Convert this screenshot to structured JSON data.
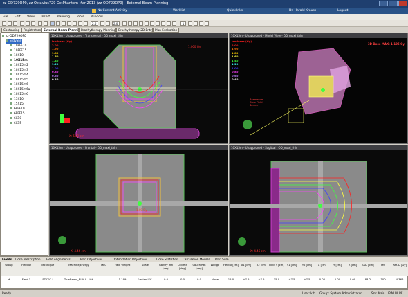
{
  "window": {
    "title": "zz-OD729OP0, zz-Octavius729 OctPhantom Mar 2013 (zz-OD729OP0) - External Beam Planning",
    "nav_activity": "No Current Activity",
    "nav_worklist": "Worklist",
    "nav_quicklinks": "Quicklinks",
    "nav_user": "Dr. Harald Krauss",
    "nav_logout": "Logout"
  },
  "menu": [
    "File",
    "Edit",
    "View",
    "Insert",
    "Planning",
    "Tools",
    "Window"
  ],
  "toolbar": {
    "zoom_a": "2.0",
    "zoom_b": "2.0",
    "page": "1"
  },
  "workspace_tabs": [
    "Contouring",
    "Registration",
    "External Beam Planning",
    "Brachytherapy Planning",
    "Brachytherapy 2D Entry",
    "Plan Evaluation"
  ],
  "tree": {
    "root": "zz-OD729OP0",
    "course": "StdvSEF",
    "plans": [
      "10FFF10",
      "10FFF15",
      "10X10",
      "10X15m",
      "10X15m2",
      "10X15m3",
      "10X15m4",
      "10X15m5",
      "10X15m6",
      "10X15m6a",
      "10X15m6",
      "15X10",
      "15X15",
      "6FFF10",
      "6FFF15",
      "6X10",
      "6X15"
    ]
  },
  "viewports": {
    "transversal": {
      "title": "10X15m - Unapproved - Transversal - OD_maxi_thin",
      "scale": "X: 5.82 cm"
    },
    "model": {
      "title": "10X15m - Unapproved - Model View - OD_maxi_thin",
      "maxlabel": "3D Dose MAX: 1.105 Gy",
      "cursor_note": "Beamzoom Dose Field Source"
    },
    "frontal": {
      "title": "10X15m - Unapproved - Frontal - OD_maxi_thin",
      "scale": "X: 4.46 cm"
    },
    "sagittal": {
      "title": "10X15m - Unapproved - Sagittal - OD_maxi_thin",
      "scale": "X: 4.46 cm"
    }
  },
  "dose_legend": {
    "heading": "Isodoses (Gy)",
    "levels": [
      "2.00",
      "1.90",
      "1.80",
      "1.60",
      "1.40",
      "1.20",
      "1.00",
      "0.80",
      "0.60",
      "0.40"
    ],
    "colors": [
      "#ff2020",
      "#ff7000",
      "#ffd000",
      "#ffff40",
      "#40ff40",
      "#40ffff",
      "#4040ff",
      "#ff40ff",
      "#c080ff",
      "#ffffff"
    ]
  },
  "bottom_tabs": [
    "Fields",
    "Dose Prescription",
    "Field Alignments",
    "Plan Objectives",
    "Optimization Objectives",
    "Dose Statistics",
    "Calculation Models",
    "Plan Sum"
  ],
  "field_table": {
    "headers": [
      "Group",
      "Field ID",
      "Technique",
      "Machine/Energy",
      "MLC",
      "Field Weight",
      "Scale",
      "Gantry Rtn [deg]",
      "Coll Rtn [deg]",
      "Couch Rtn [deg]",
      "Wedge",
      "Field X [cm]",
      "X1 [cm]",
      "X2 [cm]",
      "Field Y [cm]",
      "Y1 [cm]",
      "Y2 [cm]",
      "X [cm]",
      "Y [cm]",
      "Z [cm]",
      "SSD [cm]",
      "MU",
      "Ref. D [Gy]"
    ],
    "rows": [
      [
        "✔",
        "Field 1",
        "STATIC-I",
        "TrueBeam_BLAU - 10X",
        "",
        "1.199",
        "Varian IEC",
        "0.0",
        "0.0",
        "0.0",
        "None",
        "15.0",
        "+7.5",
        "+7.5",
        "15.0",
        "+7.5",
        "+7.5",
        "0.00",
        "0.00",
        "0.00",
        "84.2",
        "300",
        "4.366"
      ]
    ]
  },
  "status": {
    "left": "Ready",
    "user": "User: krh",
    "group": "Group: System Administrator",
    "server": "Srv: Main",
    "caps": "UP NUM RF"
  }
}
